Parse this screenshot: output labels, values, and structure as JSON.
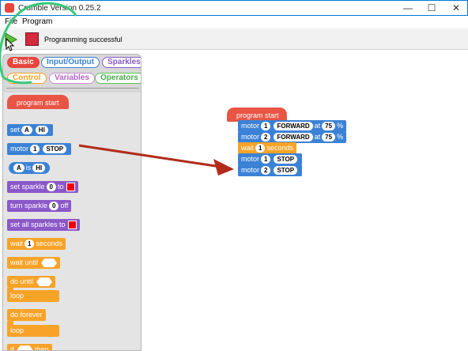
{
  "window": {
    "title": "Crumble Version 0.25.2",
    "minimize": "—",
    "maximize": "☐",
    "close": "✕"
  },
  "menu": {
    "file": "File",
    "program": "Program"
  },
  "toolbar": {
    "status": "Programming successful"
  },
  "categories": {
    "basic": "Basic",
    "input_output": "Input/Output",
    "sparkles": "Sparkles",
    "control": "Control",
    "variables": "Variables",
    "operators": "Operators"
  },
  "palette": {
    "program_start": "program start",
    "set": "set",
    "set_var": "A",
    "set_val": "HI",
    "motor": "motor",
    "motor_num": "1",
    "motor_state": "STOP",
    "is_var": "A",
    "is_word": "is",
    "is_val": "HI",
    "set_sparkle": "set sparkle",
    "sparkle_num": "0",
    "to": "to",
    "turn_sparkle": "turn sparkle",
    "turn_num": "0",
    "off": "off",
    "set_all_sparkles": "set all sparkles to",
    "wait": "wait",
    "wait_num": "1",
    "seconds": "seconds",
    "wait_until": "wait until",
    "do_until": "do until",
    "loop1": "loop",
    "do_forever": "do forever",
    "loop2": "loop",
    "partial_if": "if",
    "partial_then": "then"
  },
  "script": {
    "start": "program start",
    "b1": {
      "word": "motor",
      "num": "1",
      "dir": "FORWARD",
      "at": "at",
      "speed": "75",
      "unit": "%"
    },
    "b2": {
      "word": "motor",
      "num": "2",
      "dir": "FORWARD",
      "at": "at",
      "speed": "75",
      "unit": "%"
    },
    "b3": {
      "word": "wait",
      "num": "1",
      "unit": "seconds"
    },
    "b4": {
      "word": "motor",
      "num": "1",
      "state": "STOP"
    },
    "b5": {
      "word": "motor",
      "num": "2",
      "state": "STOP"
    }
  },
  "colors": {
    "motor_blue": "#3b82d6",
    "wait_orange": "#f7a328",
    "sparkle_purple": "#8b58c9",
    "start_red": "#e85545",
    "annotation_green": "#39c87a",
    "annotation_arrow": "#b22b1a"
  },
  "icons": {
    "run": "play-triangle-icon",
    "stop": "stop-square-icon",
    "cursor": "mouse-pointer-icon"
  }
}
